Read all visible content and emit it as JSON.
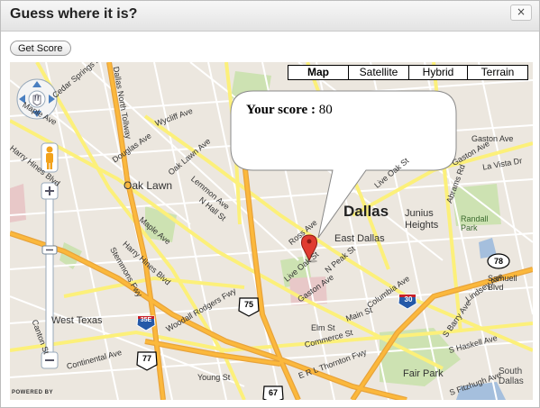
{
  "window": {
    "title": "Guess where it is?",
    "close_label": "×"
  },
  "toolbar": {
    "get_score_label": "Get Score"
  },
  "map_types": [
    "Map",
    "Satellite",
    "Hybrid",
    "Terrain"
  ],
  "score": {
    "label": "Your score :",
    "value": "80"
  },
  "map_labels": {
    "city": "Dallas",
    "area_1": "Oak Lawn",
    "area_2": "East Dallas",
    "area_3": "Junius Heights",
    "area_4": "West Texas",
    "park_1": "Randall Park",
    "park_2": "Fair Park",
    "powered_by": "POWERED BY",
    "route_30": "30",
    "route_35e": "35E",
    "route_75": "75",
    "route_78": "78",
    "route_67": "67",
    "route_77": "77"
  },
  "street_labels": [
    "Maple Ave",
    "Wycliff Ave",
    "Douglas Ave",
    "Oak Lawn Ave",
    "Lemmon Ave",
    "N Hall St",
    "Harry Hines Blvd",
    "Harry Hines Blvd",
    "Stemmons Fwy",
    "Maple Ave",
    "Woodall Rodgers Fwy",
    "Continental Ave",
    "Canton St",
    "Ross Ave",
    "N Peak St",
    "Live Oak St",
    "Live Oak St",
    "Gaston Ave",
    "Gaston Ave",
    "Elm St",
    "Main St",
    "Commerce St",
    "E R L Thornton Fwy",
    "Young St",
    "Columbia Ave",
    "Lindsey Ave",
    "Samuell Blvd",
    "La Vista Dr",
    "Abrams Rd",
    "Gaston Ave",
    "S Barry Ave",
    "S Haskell Ave",
    "S Fitzhugh Ave",
    "South Dallas",
    "Dallas North Tollway",
    "Cedar Springs Rd"
  ],
  "colors": {
    "marker": "#e03c31",
    "highway": "#fbb83c",
    "major_road": "#fcf07a",
    "water": "#a5bfdd",
    "park": "#cde2b2",
    "land": "#ece7df"
  }
}
